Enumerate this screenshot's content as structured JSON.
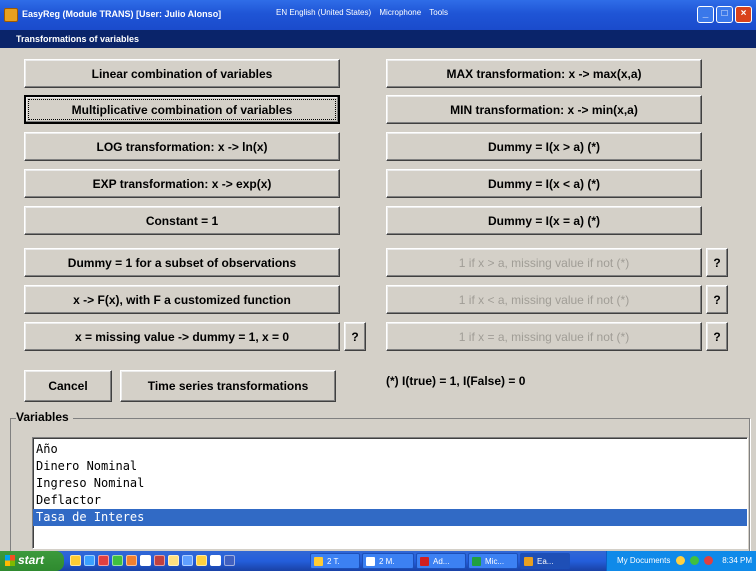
{
  "window": {
    "title": "EasyReg (Module TRANS) [User: Julio Alonso]",
    "langbar": [
      "EN English (United States)",
      "Microphone",
      "Tools"
    ],
    "subtitle": "Transformations of variables"
  },
  "left_buttons": [
    "Linear combination of variables",
    "Multiplicative combination of variables",
    "LOG transformation: x -> ln(x)",
    "EXP transformation: x -> exp(x)",
    "Constant  = 1",
    "Dummy = 1 for a subset of observations",
    "x -> F(x), with F a customized function",
    "x = missing value -> dummy = 1, x = 0"
  ],
  "right_buttons": [
    "MAX transformation: x -> max(x,a)",
    "MIN transformation: x -> min(x,a)",
    "Dummy =  I(x > a)  (*)",
    "Dummy = I(x < a)  (*)",
    "Dummy = I(x = a) (*)",
    "1 if x > a, missing value if not (*)",
    "1 if x < a, missing value if not (*)",
    "1 if x = a, missing value if not (*)"
  ],
  "help_label": "?",
  "cancel_label": "Cancel",
  "time_series_label": "Time series transformations",
  "footnote": "(*) I(true) = 1, I(False) = 0",
  "variables": {
    "label": "Variables",
    "items": [
      "Año",
      "Dinero Nominal",
      "Ingreso Nominal",
      "Deflactor",
      "Tasa de Interes"
    ],
    "selected_index": 4
  },
  "taskbar": {
    "start": "start",
    "items": [
      "2 T.",
      "2 M.",
      "Ad...",
      "Mic...",
      "Ea..."
    ],
    "tray_text": "My Documents",
    "clock": "8:34 PM"
  },
  "colors": {
    "face": "#d4d0c8",
    "title_blue": "#1f55d6",
    "subtitle_navy": "#0a246a",
    "selection": "#316ac5",
    "disabled_text": "#a09d96"
  }
}
